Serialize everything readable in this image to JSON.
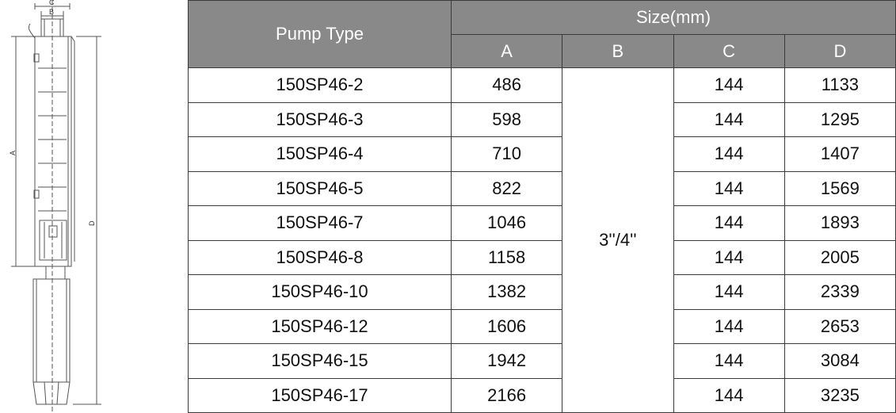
{
  "diagram": {
    "labels": {
      "a": "A",
      "b": "B",
      "c": "C",
      "d": "D"
    }
  },
  "table": {
    "header_pump_type": "Pump Type",
    "header_size": "Size(mm)",
    "columns": [
      "A",
      "B",
      "C",
      "D"
    ],
    "b_value": "3''/4''",
    "rows": [
      {
        "type": "150SP46-2",
        "a": "486",
        "c": "144",
        "d": "1133"
      },
      {
        "type": "150SP46-3",
        "a": "598",
        "c": "144",
        "d": "1295"
      },
      {
        "type": "150SP46-4",
        "a": "710",
        "c": "144",
        "d": "1407"
      },
      {
        "type": "150SP46-5",
        "a": "822",
        "c": "144",
        "d": "1569"
      },
      {
        "type": "150SP46-7",
        "a": "1046",
        "c": "144",
        "d": "1893"
      },
      {
        "type": "150SP46-8",
        "a": "1158",
        "c": "144",
        "d": "2005"
      },
      {
        "type": "150SP46-10",
        "a": "1382",
        "c": "144",
        "d": "2339"
      },
      {
        "type": "150SP46-12",
        "a": "1606",
        "c": "144",
        "d": "2653"
      },
      {
        "type": "150SP46-15",
        "a": "1942",
        "c": "144",
        "d": "3084"
      },
      {
        "type": "150SP46-17",
        "a": "2166",
        "c": "144",
        "d": "3235"
      }
    ]
  }
}
